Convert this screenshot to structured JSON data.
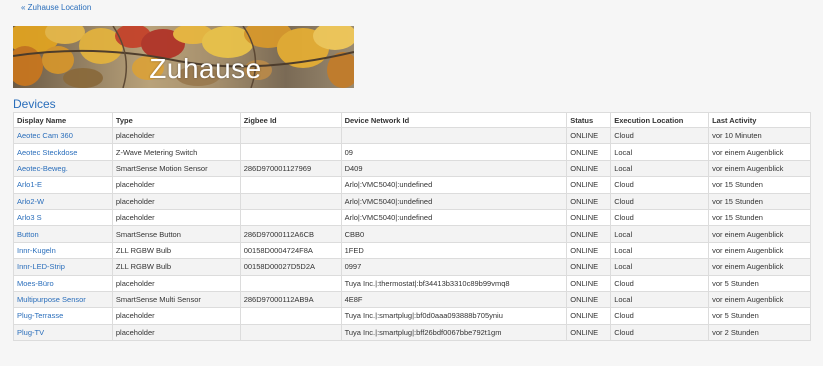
{
  "nav": {
    "back_label": "« Zuhause Location"
  },
  "banner": {
    "title": "Zuhause"
  },
  "devices_section": {
    "heading": "Devices"
  },
  "table": {
    "headers": [
      "Display Name",
      "Type",
      "Zigbee Id",
      "Device Network Id",
      "Status",
      "Execution Location",
      "Last Activity"
    ],
    "rows": [
      [
        "Aeotec Cam 360",
        "placeholder",
        "",
        "",
        "ONLINE",
        "Cloud",
        "vor 10 Minuten"
      ],
      [
        "Aeotec Steckdose",
        "Z-Wave Metering Switch",
        "",
        "09",
        "ONLINE",
        "Local",
        "vor einem Augenblick"
      ],
      [
        "Aeotec-Beweg.",
        "SmartSense Motion Sensor",
        "286D970001127969",
        "D409",
        "ONLINE",
        "Local",
        "vor einem Augenblick"
      ],
      [
        "Arlo1-E",
        "placeholder",
        "",
        "Arlo|:VMC5040|:undefined",
        "ONLINE",
        "Cloud",
        "vor 15 Stunden"
      ],
      [
        "Arlo2-W",
        "placeholder",
        "",
        "Arlo|:VMC5040|:undefined",
        "ONLINE",
        "Cloud",
        "vor 15 Stunden"
      ],
      [
        "Arlo3 S",
        "placeholder",
        "",
        "Arlo|:VMC5040|:undefined",
        "ONLINE",
        "Cloud",
        "vor 15 Stunden"
      ],
      [
        "Button",
        "SmartSense Button",
        "286D97000112A6CB",
        "CBB0",
        "ONLINE",
        "Local",
        "vor einem Augenblick"
      ],
      [
        "Innr-Kugeln",
        "ZLL RGBW Bulb",
        "00158D0004724F8A",
        "1FED",
        "ONLINE",
        "Local",
        "vor einem Augenblick"
      ],
      [
        "Innr-LED-Strip",
        "ZLL RGBW Bulb",
        "00158D00027D5D2A",
        "0997",
        "ONLINE",
        "Local",
        "vor einem Augenblick"
      ],
      [
        "Moes-Büro",
        "placeholder",
        "",
        "Tuya Inc.|:thermostat|:bf34413b3310c89b99vmq8",
        "ONLINE",
        "Cloud",
        "vor 5 Stunden"
      ],
      [
        "Multipurpose Sensor",
        "SmartSense Multi Sensor",
        "286D97000112AB9A",
        "4E8F",
        "ONLINE",
        "Local",
        "vor einem Augenblick"
      ],
      [
        "Plug-Terrasse",
        "placeholder",
        "",
        "Tuya Inc.|:smartplug|:bf0d0aaa093888b705yniu",
        "ONLINE",
        "Cloud",
        "vor 5 Stunden"
      ],
      [
        "Plug-TV",
        "placeholder",
        "",
        "Tuya Inc.|:smartplug|:bff26bdf0067bbe792t1gm",
        "ONLINE",
        "Cloud",
        "vor 2 Stunden"
      ]
    ]
  },
  "colors": {
    "link": "#2a6ebb",
    "banner_text": "#ffffff"
  }
}
